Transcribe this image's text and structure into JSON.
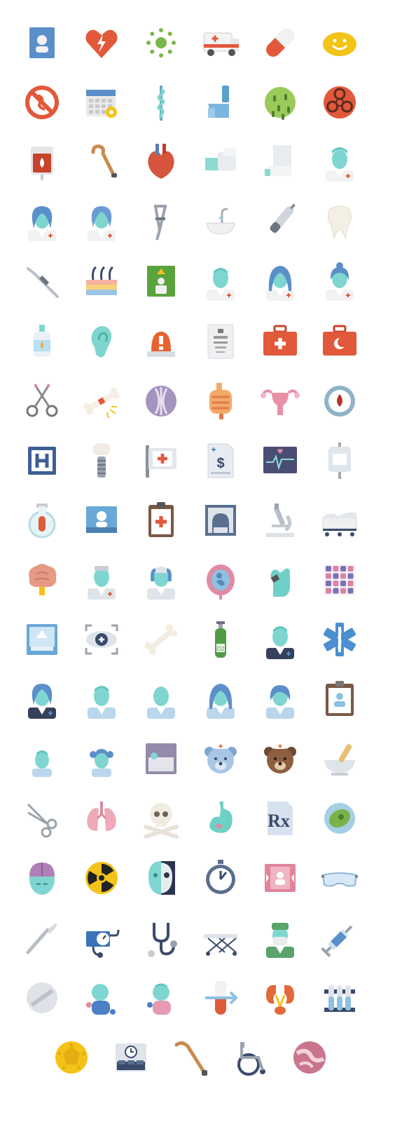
{
  "icon_sheet": {
    "theme": "medical flat icons",
    "colors": {
      "orange_red": "#e2583a",
      "teal": "#7fd6d0",
      "blue": "#5b8fc9",
      "navy": "#3a4a6b",
      "gold": "#f3c318",
      "grey": "#b8bec6",
      "pink": "#e08aa3",
      "green": "#7ab648"
    },
    "rows": [
      [
        "id-card-icon",
        "heart-bolt-icon",
        "virus-icon",
        "ambulance-icon",
        "pill-capsule-icon",
        "smiley-pill-icon"
      ],
      [
        "no-drugs-icon",
        "appointment-calendar-icon",
        "rod-of-asclepius-icon",
        "inhaler-icon",
        "bacteria-icon",
        "biohazard-icon"
      ],
      [
        "blood-bag-icon",
        "walking-cane-icon",
        "anatomical-heart-icon",
        "arm-cast-icon",
        "leg-cast-icon",
        "male-doctor-icon"
      ],
      [
        "female-doctor-icon",
        "female-doctor-alt-icon",
        "crutch-icon",
        "sink-icon",
        "dental-drill-icon",
        "tooth-icon"
      ],
      [
        "dental-probe-icon",
        "skin-layers-icon",
        "elevator-patient-icon",
        "male-doctor-alt-icon",
        "female-doctor-long-hair-icon",
        "female-doctor-bun-icon"
      ],
      [
        "eye-drops-icon",
        "ear-icon",
        "emergency-light-icon",
        "eye-chart-icon",
        "first-aid-kit-icon",
        "crescent-aid-kit-icon"
      ],
      [
        "forceps-icon",
        "broken-bone-icon",
        "dna-circle-icon",
        "intestine-icon",
        "uterus-icon",
        "blood-drop-icon"
      ],
      [
        "hospital-sign-icon",
        "dental-implant-icon",
        "hospital-flag-icon",
        "medical-bill-icon",
        "heart-monitor-icon",
        "iv-drip-icon"
      ],
      [
        "test-flask-icon",
        "patient-photo-icon",
        "medical-clipboard-icon",
        "mri-scanner-icon",
        "microscope-icon",
        "hospital-bed-icon"
      ],
      [
        "brain-icon",
        "male-nurse-icon",
        "female-nurse-icon",
        "pregnancy-icon",
        "gloved-hand-pill-icon",
        "pill-blister-icon"
      ],
      [
        "xray-bed-icon",
        "scan-eye-icon",
        "bone-icon",
        "oxygen-tank-icon",
        "paramedic-icon",
        "star-of-life-icon"
      ],
      [
        "female-paramedic-icon",
        "patient-man-icon",
        "patient-bald-icon",
        "patient-woman-icon",
        "patient-girl-icon",
        "medical-record-icon"
      ],
      [
        "child-boy-icon",
        "child-girl-icon",
        "patient-in-bed-icon",
        "teddy-bear-nurse-icon",
        "teddy-bear-brown-icon",
        "mortar-pestle-icon"
      ],
      [
        "surgical-scissors-icon",
        "lungs-icon",
        "skull-crossbones-icon",
        "stomach-icon",
        "prescription-icon",
        "germ-icon"
      ],
      [
        "head-brain-icon",
        "radiation-icon",
        "half-skull-face-icon",
        "stopwatch-icon",
        "patient-card-icon",
        "safety-goggles-icon"
      ],
      [
        "scalpel-icon",
        "blood-pressure-icon",
        "stethoscope-icon",
        "stretcher-icon",
        "surgeon-icon",
        "syringe-icon"
      ],
      [
        "tablet-icon",
        "baby-boy-icon",
        "baby-girl-icon",
        "capsule-arrow-icon",
        "kidneys-icon",
        "test-tubes-icon"
      ],
      [
        "virus-coin-icon",
        "waiting-room-icon",
        "walking-stick-icon",
        "wheelchair-icon",
        "cell-icon"
      ]
    ]
  }
}
